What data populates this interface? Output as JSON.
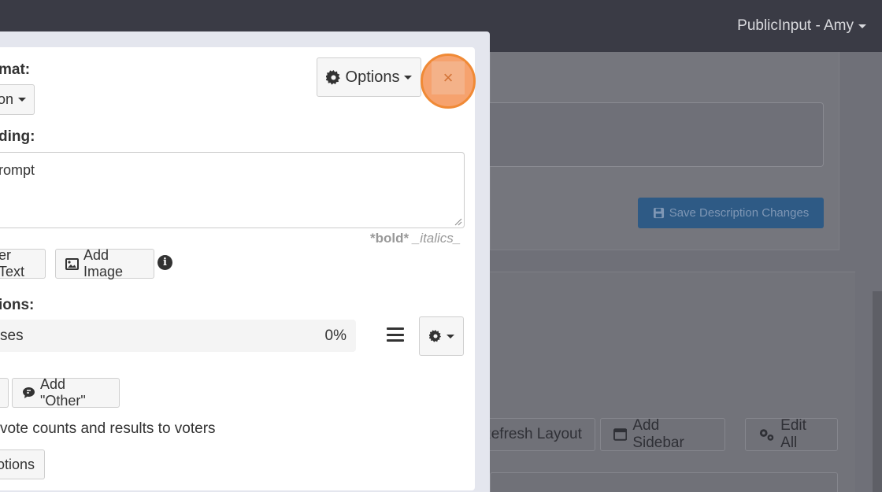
{
  "topnav": {
    "user_label": "PublicInput - Amy"
  },
  "background": {
    "save_label": "Save Description Changes",
    "refresh_label": "Refresh Layout",
    "sidebar_label": "Add Sidebar",
    "edit_all_label": "Edit All"
  },
  "modal": {
    "format_label": "mat:",
    "format_value": "on",
    "options_label": "Options",
    "close_label": "×",
    "heading_label": "ding:",
    "heading_value": "rompt",
    "markdown_bold": "*bold*",
    "markdown_italics": "_italics_",
    "other_text_label": "er Text",
    "add_image_label": "Add Image",
    "info_label": "i",
    "options_section_label": "ions:",
    "option_item": {
      "label": "ses",
      "percent": "0%"
    },
    "add_other_label": "Add \"Other\"",
    "vote_text": "vote counts and results to voters",
    "more_options_label": "otions"
  }
}
